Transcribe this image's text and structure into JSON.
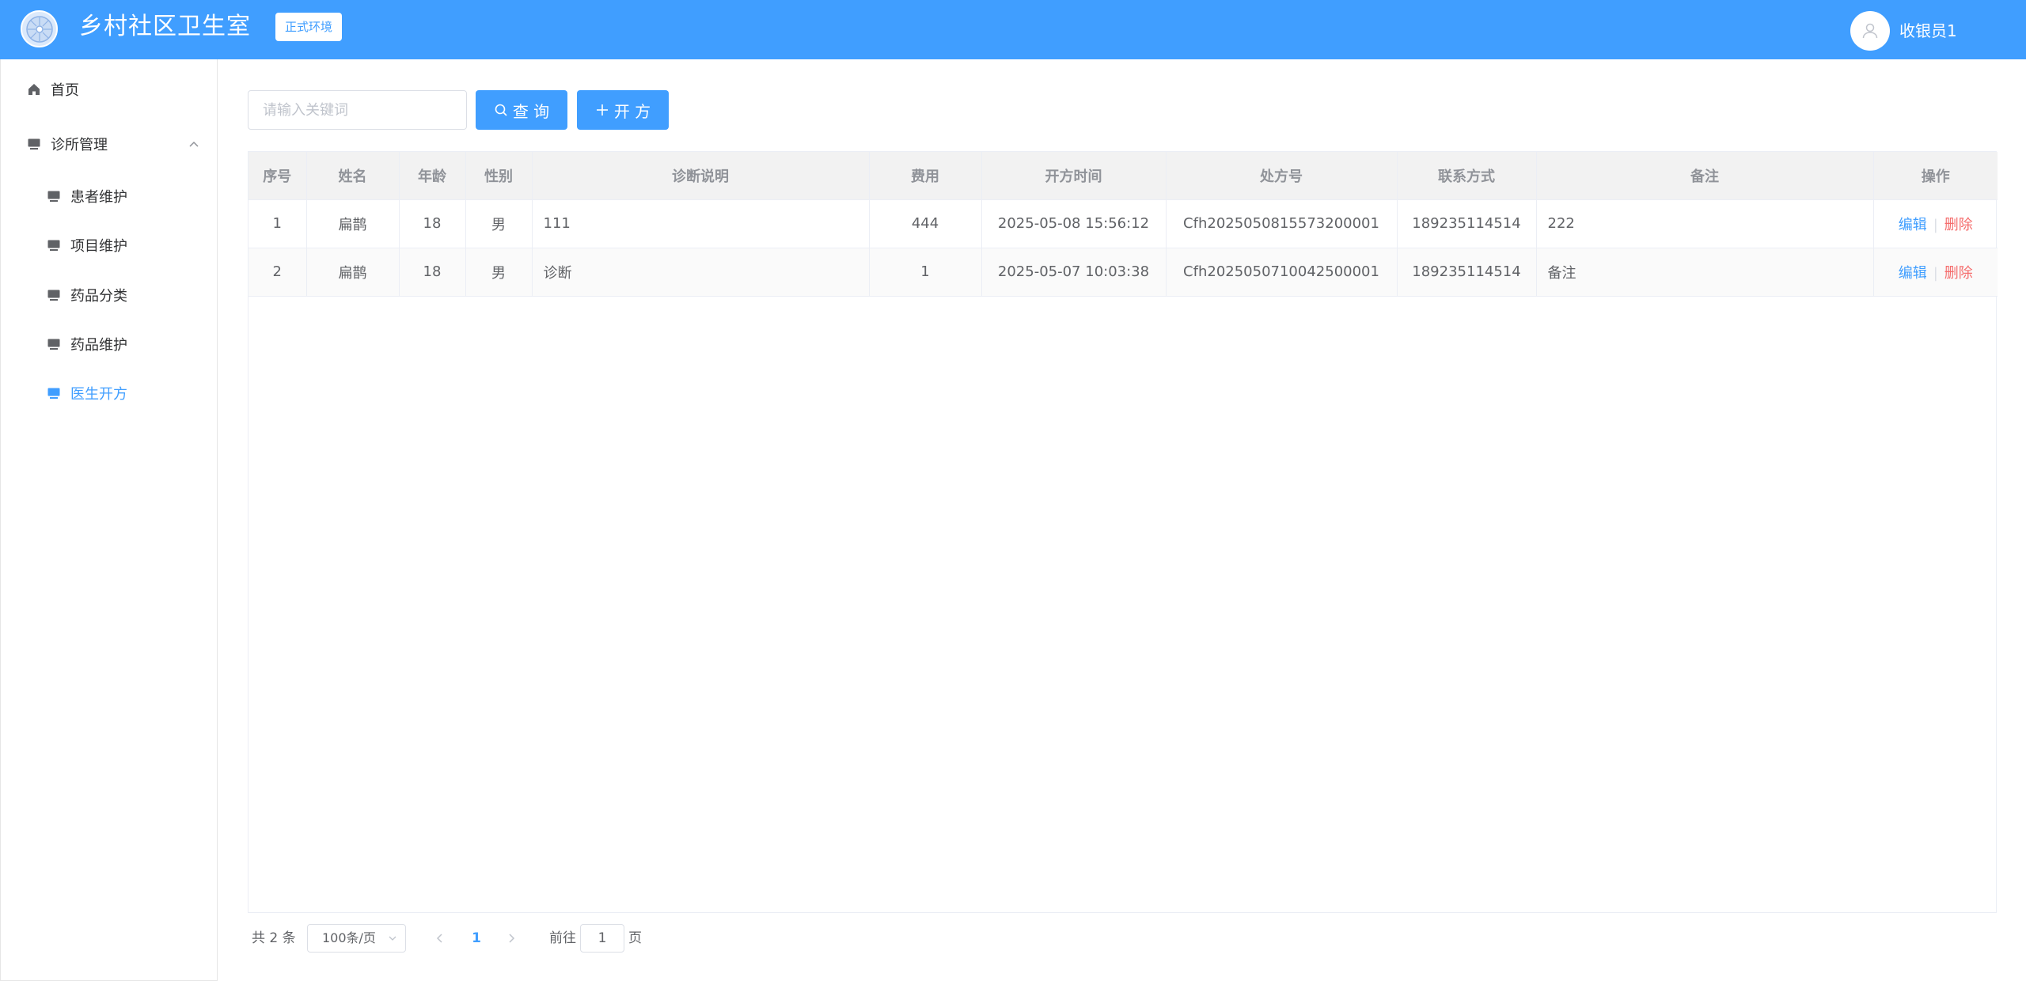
{
  "header": {
    "app_title": "乡村社区卫生室",
    "env_badge": "正式环境",
    "user_name": "收银员1"
  },
  "sidebar": {
    "items": [
      {
        "label": "首页",
        "icon": "home-icon"
      },
      {
        "label": "诊所管理",
        "icon": "monitor-icon",
        "expanded": true
      },
      {
        "label": "患者维护",
        "icon": "monitor-icon"
      },
      {
        "label": "项目维护",
        "icon": "monitor-icon"
      },
      {
        "label": "药品分类",
        "icon": "monitor-icon"
      },
      {
        "label": "药品维护",
        "icon": "monitor-icon"
      },
      {
        "label": "医生开方",
        "icon": "monitor-icon",
        "active": true
      }
    ]
  },
  "toolbar": {
    "search_placeholder": "请输入关键词",
    "search_value": "",
    "query_label": "查 询",
    "add_label": "开 方"
  },
  "table": {
    "columns": [
      "序号",
      "姓名",
      "年龄",
      "性别",
      "诊断说明",
      "费用",
      "开方时间",
      "处方号",
      "联系方式",
      "备注",
      "操作"
    ],
    "rows": [
      {
        "index": "1",
        "name": "扁鹊",
        "age": "18",
        "gender": "男",
        "diagnosis": "111",
        "fee": "444",
        "time": "2025-05-08 15:56:12",
        "rx_no": "Cfh2025050815573200001",
        "phone": "189235114514",
        "remark": "222"
      },
      {
        "index": "2",
        "name": "扁鹊",
        "age": "18",
        "gender": "男",
        "diagnosis": "诊断",
        "fee": "1",
        "time": "2025-05-07 10:03:38",
        "rx_no": "Cfh2025050710042500001",
        "phone": "189235114514",
        "remark": "备注"
      }
    ],
    "actions": {
      "edit": "编辑",
      "sep": "|",
      "delete": "删除"
    }
  },
  "pagination": {
    "total_text": "共 2 条",
    "page_size": "100条/页",
    "current_page": "1",
    "goto_label": "前往",
    "goto_value": "1",
    "goto_suffix": "页"
  },
  "colors": {
    "primary": "#409eff",
    "danger": "#f56c6c"
  }
}
